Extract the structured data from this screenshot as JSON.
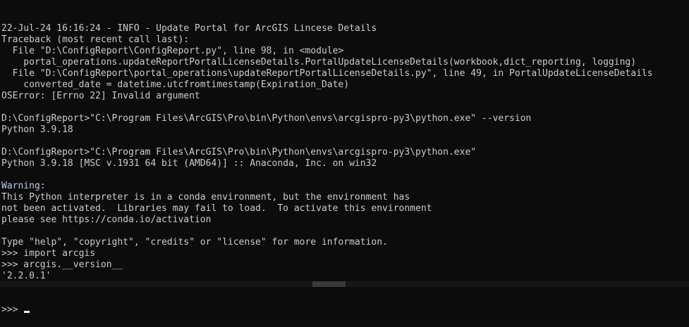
{
  "console": {
    "lines": [
      "22-Jul-24 16:16:24 - INFO - Update Portal for ArcGIS Lincese Details",
      "Traceback (most recent call last):",
      "  File \"D:\\ConfigReport\\ConfigReport.py\", line 98, in <module>",
      "    portal_operations.updateReportPortalLicenseDetails.PortalUpdateLicenseDetails(workbook,dict_reporting, logging)",
      "  File \"D:\\ConfigReport\\portal_operations\\updateReportPortalLicenseDetails.py\", line 49, in PortalUpdateLicenseDetails",
      "    converted_date = datetime.utcfromtimestamp(Expiration_Date)",
      "OSError: [Errno 22] Invalid argument",
      "",
      "D:\\ConfigReport>\"C:\\Program Files\\ArcGIS\\Pro\\bin\\Python\\envs\\arcgispro-py3\\python.exe\" --version",
      "Python 3.9.18",
      "",
      "D:\\ConfigReport>\"C:\\Program Files\\ArcGIS\\Pro\\bin\\Python\\envs\\arcgispro-py3\\python.exe\"",
      "Python 3.9.18 [MSC v.1931 64 bit (AMD64)] :: Anaconda, Inc. on win32",
      "",
      "Warning:",
      "This Python interpreter is in a conda environment, but the environment has",
      "not been activated.  Libraries may fail to load.  To activate this environment",
      "please see https://conda.io/activation",
      "",
      "Type \"help\", \"copyright\", \"credits\" or \"license\" for more information.",
      ">>> import arcgis",
      ">>> arcgis.__version__",
      "'2.2.0.1'"
    ],
    "prompt": ">>> "
  }
}
